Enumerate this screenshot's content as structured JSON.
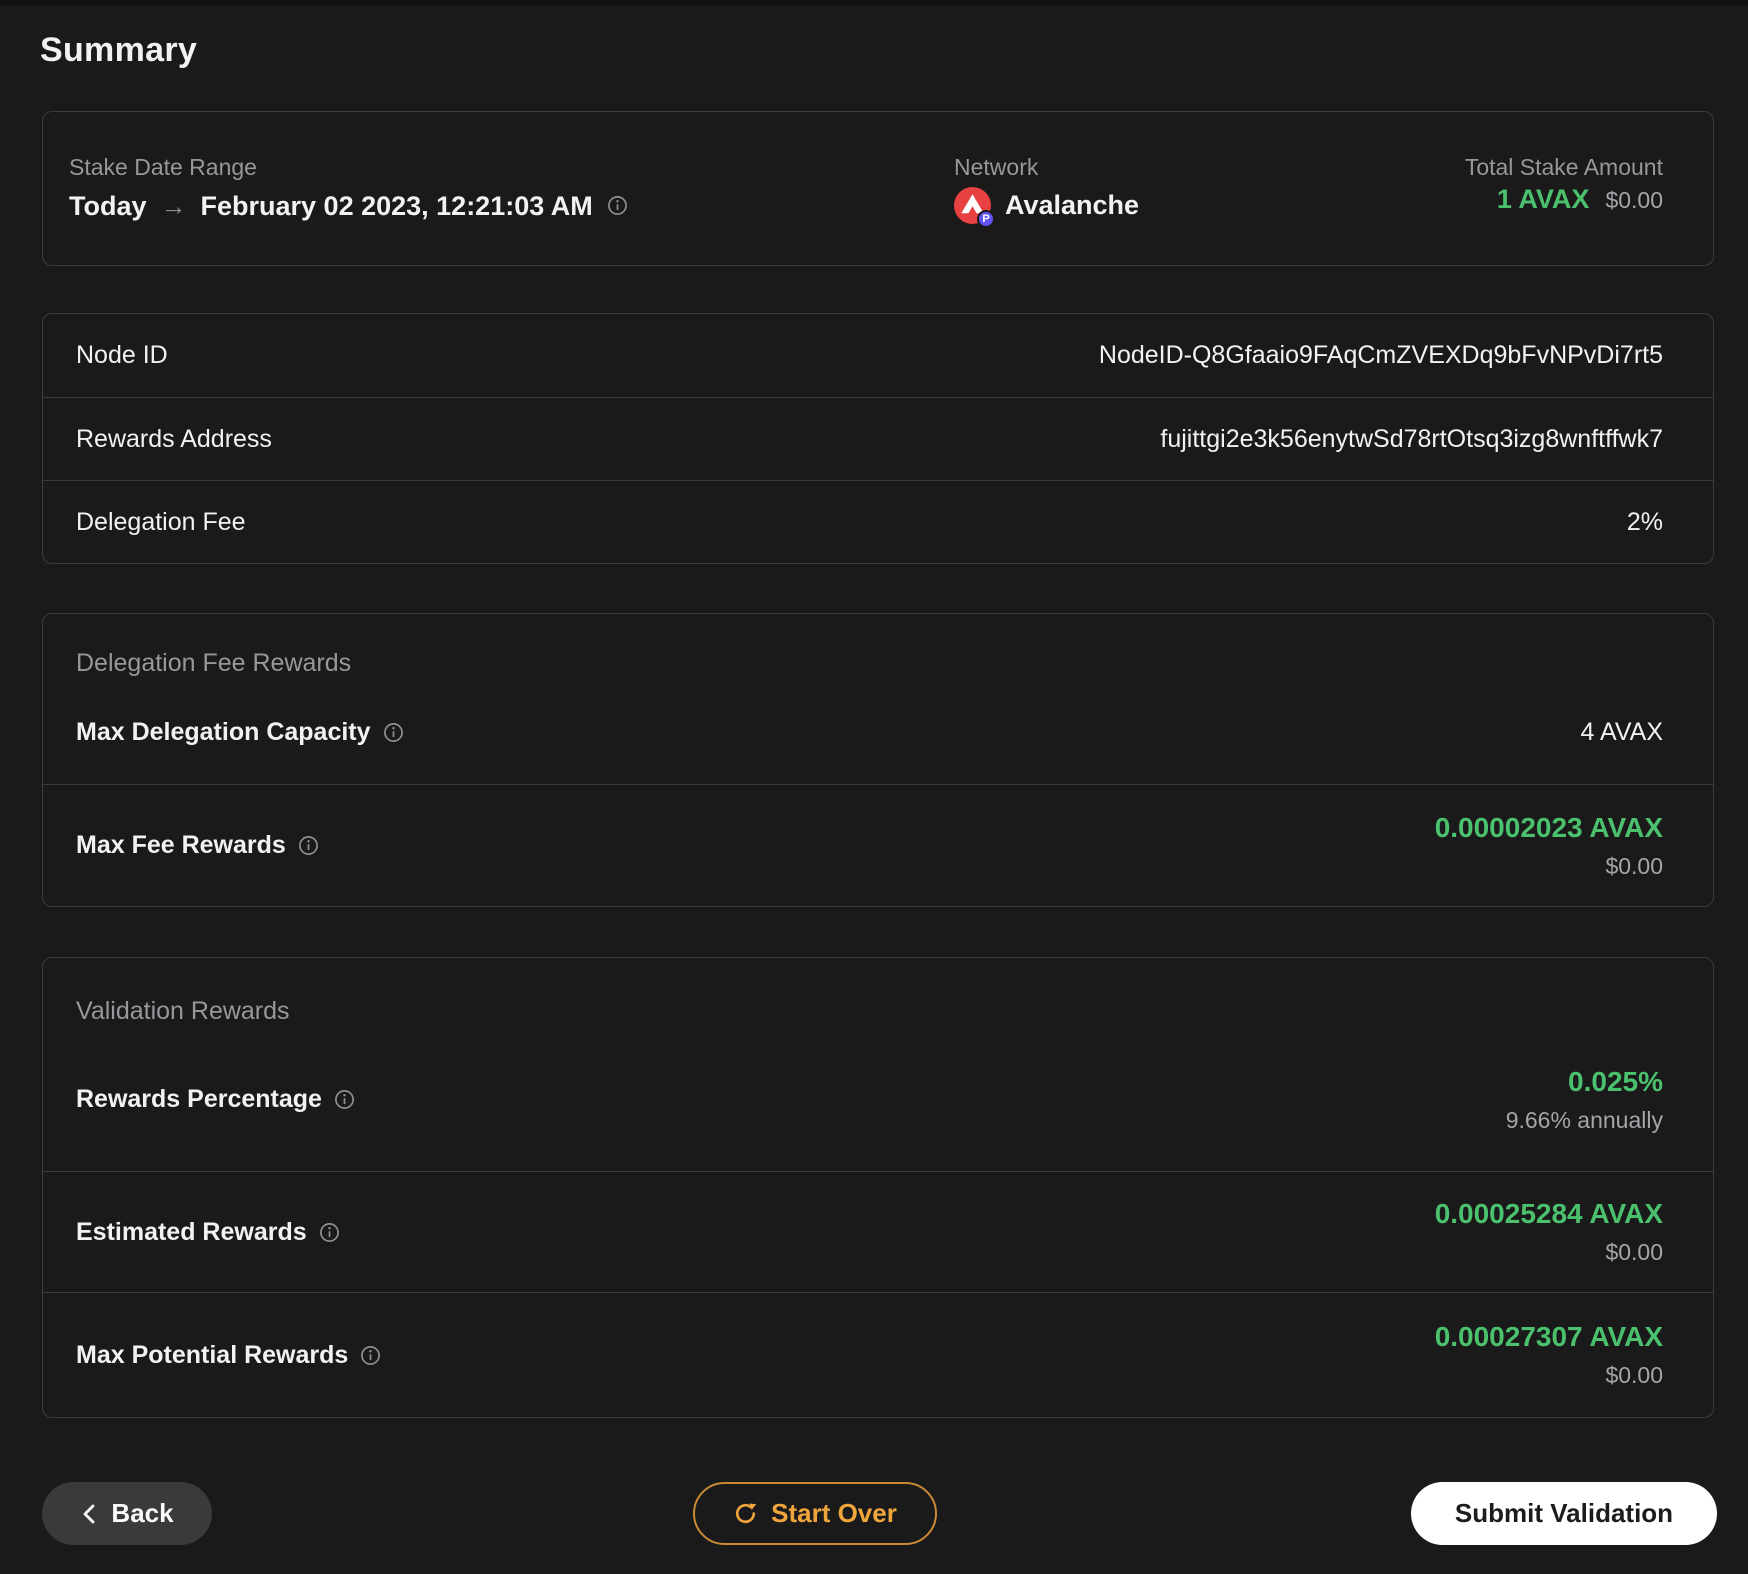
{
  "header": {
    "title": "Summary"
  },
  "colors": {
    "accent_green": "#4BC16D",
    "accent_orange": "#EFA43C",
    "avalanche_red": "#E84142",
    "pchain_badge_purple": "#6152F4",
    "background": "#1A1A1B"
  },
  "stake": {
    "date": {
      "label": "Stake Date Range",
      "start": "Today",
      "arrow": "→",
      "end": "February 02 2023, 12:21:03 AM"
    },
    "network": {
      "label": "Network",
      "name": "Avalanche",
      "badge": "P"
    },
    "total": {
      "label": "Total Stake Amount",
      "amount": "1 AVAX",
      "fiat": "$0.00"
    }
  },
  "details": {
    "rows": [
      {
        "label": "Node ID",
        "value": "NodeID-Q8Gfaaio9FAqCmZVEXDq9bFvNPvDi7rt5"
      },
      {
        "label": "Rewards Address",
        "value": "fujittgi2e3k56enytwSd78rtOtsq3izg8wnftffwk7"
      },
      {
        "label": "Delegation Fee",
        "value": "2%"
      }
    ]
  },
  "fee_section": {
    "title": "Delegation Fee Rewards",
    "capacity": {
      "label": "Max Delegation Capacity",
      "value": "4 AVAX"
    },
    "max_fee": {
      "label": "Max Fee Rewards",
      "value": "0.00002023 AVAX",
      "fiat": "$0.00"
    }
  },
  "validation_section": {
    "title": "Validation Rewards",
    "rows": [
      {
        "label": "Rewards Percentage",
        "value": "0.025%",
        "sub": "9.66% annually"
      },
      {
        "label": "Estimated Rewards",
        "value": "0.00025284 AVAX",
        "sub": "$0.00"
      },
      {
        "label": "Max Potential Rewards",
        "value": "0.00027307 AVAX",
        "sub": "$0.00"
      }
    ]
  },
  "footer": {
    "back_label": "Back",
    "start_over_label": "Start Over",
    "submit_label": "Submit Validation"
  }
}
